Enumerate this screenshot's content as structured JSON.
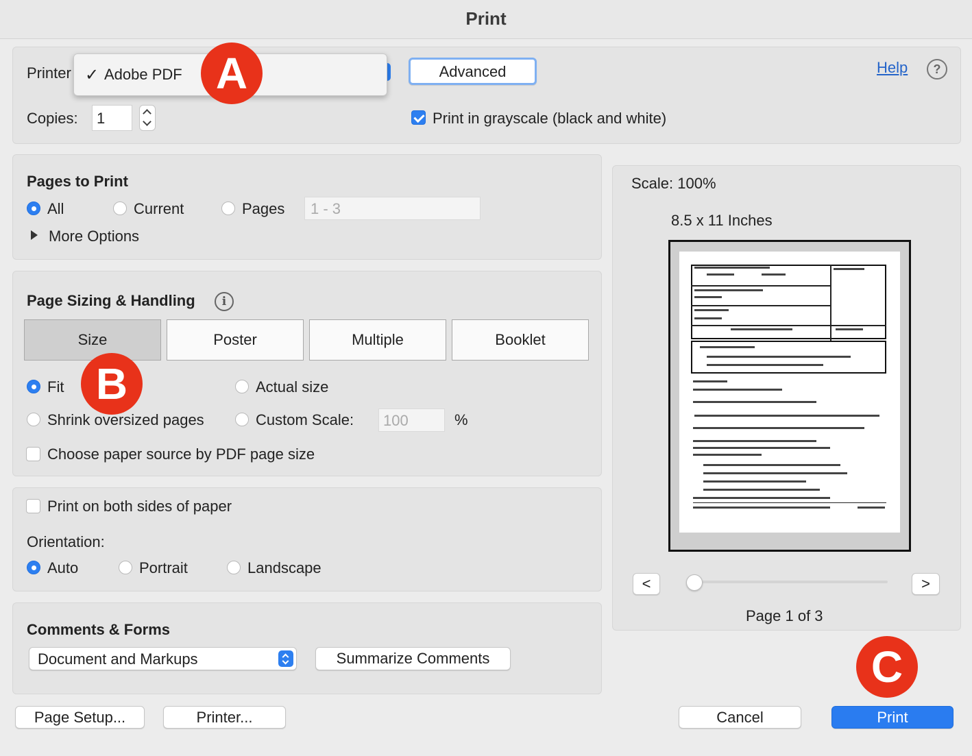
{
  "window": {
    "title": "Print"
  },
  "printer": {
    "label": "Printer",
    "selected": "Adobe PDF",
    "checkmark": "✓",
    "advanced_label": "Advanced",
    "help_label": "Help",
    "help_icon": "?"
  },
  "copies": {
    "label": "Copies:",
    "value": "1"
  },
  "grayscale": {
    "label": "Print in grayscale (black and white)",
    "checked": true
  },
  "pages_to_print": {
    "heading": "Pages to Print",
    "options": [
      "All",
      "Current",
      "Pages"
    ],
    "selected": "All",
    "range_placeholder": "1 - 3",
    "more_options": "More Options"
  },
  "sizing": {
    "heading": "Page Sizing & Handling",
    "info_icon": "i",
    "tabs": [
      "Size",
      "Poster",
      "Multiple",
      "Booklet"
    ],
    "selected_tab": "Size",
    "fit": "Fit",
    "shrink": "Shrink oversized pages",
    "actual": "Actual size",
    "custom": "Custom Scale:",
    "custom_value": "100",
    "percent": "%",
    "paper_source": "Choose paper source by PDF page size",
    "selected": "Fit"
  },
  "duplex": {
    "both_sides": "Print on both sides of paper",
    "orientation_label": "Orientation:",
    "orientations": [
      "Auto",
      "Portrait",
      "Landscape"
    ],
    "selected": "Auto"
  },
  "comments": {
    "heading": "Comments & Forms",
    "select_value": "Document and Markups",
    "summarize": "Summarize Comments"
  },
  "preview": {
    "scale": "Scale: 100%",
    "paper": "8.5 x 11 Inches",
    "prev": "<",
    "next": ">",
    "page_info": "Page 1 of 3",
    "slider_position": 0
  },
  "footer": {
    "page_setup": "Page Setup...",
    "printer": "Printer...",
    "cancel": "Cancel",
    "print": "Print"
  },
  "badges": {
    "a": "A",
    "b": "B",
    "c": "C"
  },
  "colors": {
    "accent": "#2d7ff0",
    "badge": "#e8321a",
    "link": "#2464c9"
  }
}
